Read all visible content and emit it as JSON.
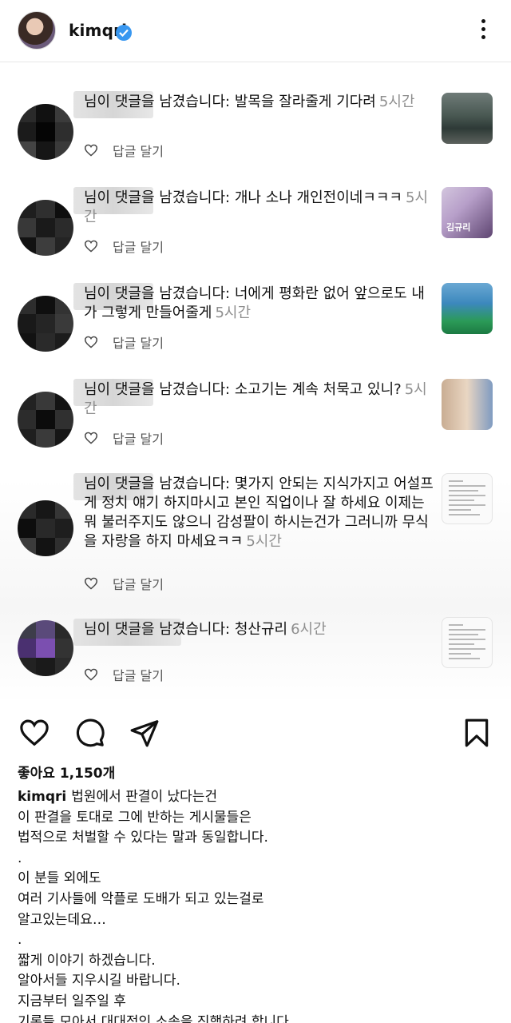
{
  "header": {
    "username": "kimqri"
  },
  "notifications": [
    {
      "text": "님이 댓글을 남겼습니다: 발목을 잘라줄게 기다려",
      "time": "5시간",
      "reply_label": "답글 달기",
      "thumb_label": ""
    },
    {
      "text": "님이 댓글을 남겼습니다: 개나 소나 개인전이네ㅋㅋㅋ",
      "time": "5시간",
      "reply_label": "답글 달기",
      "thumb_label": "김규리"
    },
    {
      "text": "님이 댓글을 남겼습니다: 너에게 평화란 없어 앞으로도 내가 그렇게 만들어줄게",
      "time": "5시간",
      "reply_label": "답글 달기",
      "thumb_label": ""
    },
    {
      "text": "님이 댓글을 남겼습니다: 소고기는 계속 처묵고 있니?",
      "time": "5시간",
      "reply_label": "답글 달기",
      "thumb_label": ""
    },
    {
      "text": "님이 댓글을 남겼습니다: 몇가지 안되는 지식가지고 어설프게 정치 얘기 하지마시고 본인 직업이나 잘 하세요 이제는 뭐 불러주지도 않으니 감성팔이 하시는건가  그러니까 무식을 자랑을 하지 마세요ㅋㅋ",
      "time": "5시간",
      "reply_label": "답글 달기",
      "thumb_label": ""
    },
    {
      "text": "님이 댓글을 남겼습니다: 청산규리",
      "time": "6시간",
      "reply_label": "답글 달기",
      "thumb_label": ""
    }
  ],
  "post": {
    "likes": "좋아요 1,150개",
    "caption_user": "kimqri",
    "caption_lines": [
      "법원에서 판결이 났다는건",
      "이 판결을 토대로 그에 반하는 게시물들은",
      "법적으로 처벌할 수 있다는 말과 동일합니다.",
      ".",
      "이 분들 외에도",
      "여러 기사들에 악플로 도배가 되고 있는걸로",
      "알고있는데요…",
      ".",
      "짧게 이야기 하겠습니다.",
      "알아서들 지우시길 바랍니다.",
      "지금부터 일주일 후",
      "기록들 모아서 대대적인 소송을 진행하려 합니다."
    ]
  },
  "icons": {
    "verified": "verified-badge-icon",
    "more": "more-vertical-icon",
    "heart": "heart-icon",
    "comment": "comment-icon",
    "share": "share-icon",
    "save": "bookmark-icon"
  }
}
